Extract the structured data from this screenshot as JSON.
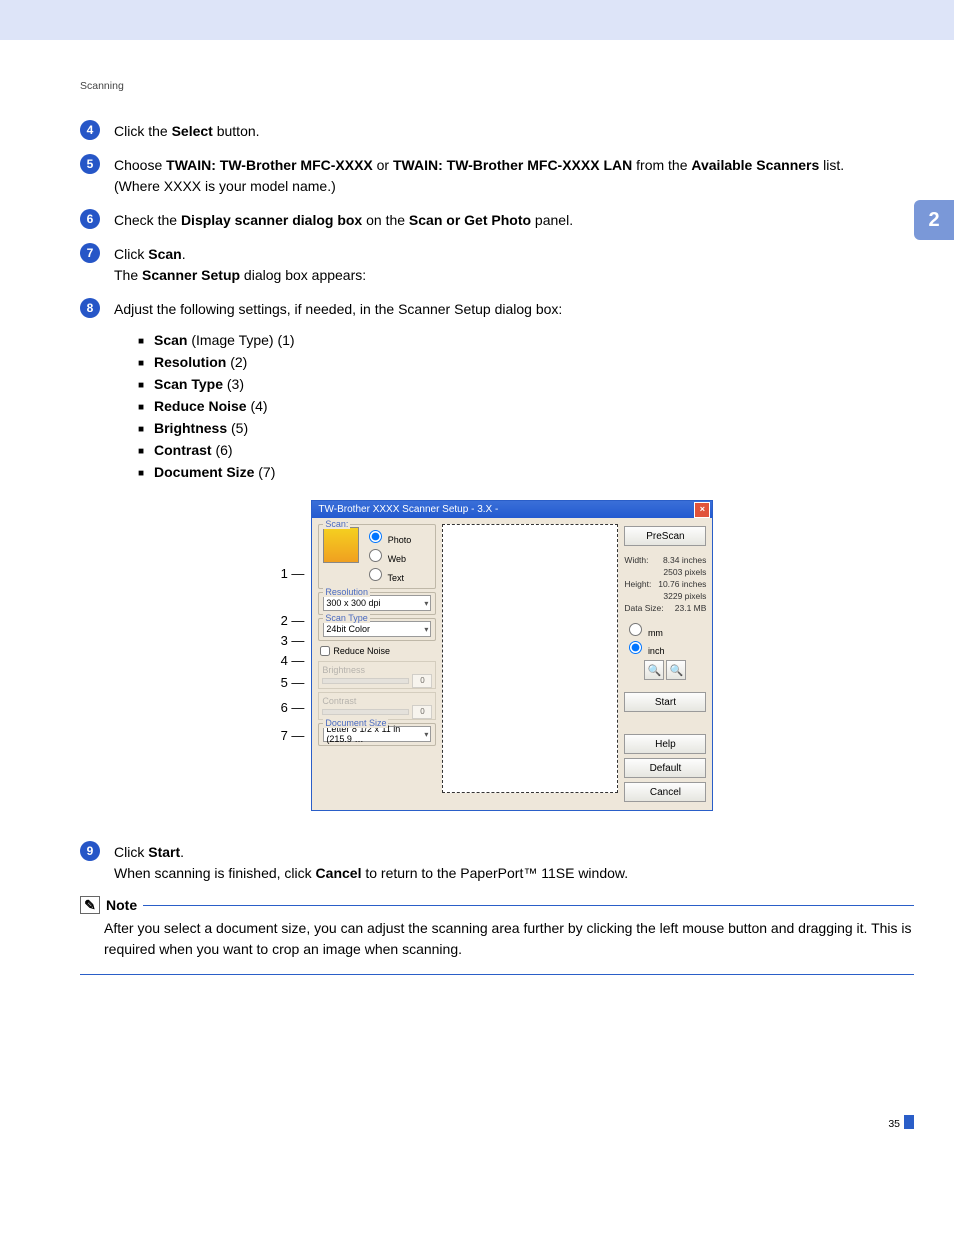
{
  "header": "Scanning",
  "chapter": "2",
  "steps": {
    "s4": {
      "num": "4",
      "pre": "Click the ",
      "bold": "Select",
      "post": " button."
    },
    "s5": {
      "num": "5",
      "l1_pre": "Choose ",
      "l1_b1": "TWAIN: TW-Brother MFC-XXXX",
      "l1_mid": " or ",
      "l1_b2": "TWAIN: TW-Brother MFC-XXXX LAN",
      "l1_mid2": " from the ",
      "l1_b3": "Available Scanners",
      "l1_post": " list.",
      "l2": "(Where XXXX is your model name.)"
    },
    "s6": {
      "num": "6",
      "pre": "Check the ",
      "b1": "Display scanner dialog box",
      "mid": " on the ",
      "b2": "Scan or Get Photo",
      "post": " panel."
    },
    "s7": {
      "num": "7",
      "l1_pre": "Click ",
      "l1_b": "Scan",
      "l1_post": ".",
      "l2_pre": "The ",
      "l2_b": "Scanner Setup",
      "l2_post": " dialog box appears:"
    },
    "s8": {
      "num": "8",
      "intro": "Adjust the following settings, if needed, in the Scanner Setup dialog box:",
      "items": [
        {
          "b": "Scan",
          "rest": " (Image Type) (1)"
        },
        {
          "b": "Resolution",
          "rest": " (2)"
        },
        {
          "b": "Scan Type",
          "rest": " (3)"
        },
        {
          "b": "Reduce Noise",
          "rest": " (4)"
        },
        {
          "b": "Brightness",
          "rest": " (5)"
        },
        {
          "b": "Contrast",
          "rest": " (6)"
        },
        {
          "b": "Document Size",
          "rest": " (7)"
        }
      ]
    },
    "s9": {
      "num": "9",
      "l1_pre": "Click ",
      "l1_b": "Start",
      "l1_post": ".",
      "l2_pre": "When scanning is finished, click ",
      "l2_b": "Cancel",
      "l2_post": " to return to the PaperPort™ 11SE window."
    }
  },
  "note": {
    "heading": "Note",
    "body": "After you select a document size, you can adjust the scanning area further by clicking the left mouse button and dragging it. This is required when you want to crop an image when scanning."
  },
  "dialog": {
    "title": "TW-Brother XXXX Scanner Setup - 3.X -",
    "scanLegend": "Scan:",
    "radioPhoto": "Photo",
    "radioWeb": "Web",
    "radioText": "Text",
    "resolutionLegend": "Resolution",
    "resolutionValue": "300 x 300 dpi",
    "scanTypeLegend": "Scan Type",
    "scanTypeValue": "24bit Color",
    "reduceNoise": "Reduce Noise",
    "brightnessLabel": "Brightness",
    "brightnessValue": "0",
    "contrastLabel": "Contrast",
    "contrastValue": "0",
    "docSizeLegend": "Document Size",
    "docSizeValue": "Letter 8 1/2 x 11 in (215.9 …",
    "btnPreScan": "PreScan",
    "widthLabel": "Width:",
    "widthVal": "8.34 inches",
    "widthPx": "2503 pixels",
    "heightLabel": "Height:",
    "heightVal": "10.76 inches",
    "heightPx": "3229 pixels",
    "dataSizeLabel": "Data Size:",
    "dataSizeVal": "23.1 MB",
    "unitMm": "mm",
    "unitInch": "inch",
    "btnStart": "Start",
    "btnHelp": "Help",
    "btnDefault": "Default",
    "btnCancel": "Cancel"
  },
  "callouts": {
    "c1": "1",
    "c2": "2",
    "c3": "3",
    "c4": "4",
    "c5": "5",
    "c6": "6",
    "c7": "7"
  },
  "pageNumber": "35"
}
